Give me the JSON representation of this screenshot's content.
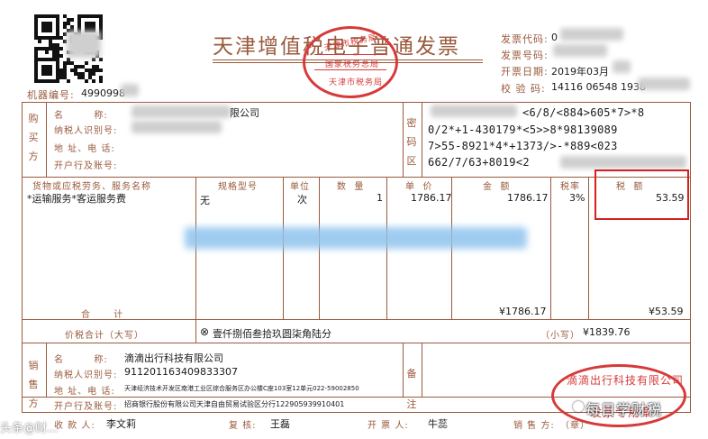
{
  "title": "天津增值税电子普通发票",
  "meta": {
    "code_label": "发票代码:",
    "code_value": "0",
    "number_label": "发票号码:",
    "number_value": "",
    "date_label": "开票日期:",
    "date_value": "2019年03月",
    "check_label": "校 验 码:",
    "check_value": "14116 06548 1938"
  },
  "machine": {
    "label": "机器编号:",
    "value": "4990998"
  },
  "buyer": {
    "section_label": [
      "购",
      "买",
      "方"
    ],
    "name_label": "名        称:",
    "name_value": "限公司",
    "tax_id_label": "纳税人识别号:",
    "address_label": "地 址、电 话:",
    "bank_label": "开户行及账号:"
  },
  "cipher": {
    "section_label": [
      "密",
      "码",
      "区"
    ],
    "lines": [
      "<6/8/<884>605*7>*8",
      "0/2*+1-430179*<5>>8*98139089",
      "7>55-8921*4*+1373/>-*889<023",
      "662/7/63+8019<2"
    ]
  },
  "items_header": {
    "name": "货物或应税劳务、服务名称",
    "spec": "规格型号",
    "unit": "单位",
    "quantity": "数  量",
    "price": "单  价",
    "amount": "金  额",
    "tax_rate": "税率",
    "tax": "税  额"
  },
  "items": [
    {
      "name": "*运输服务*客运服务费",
      "spec": "无",
      "unit": "次",
      "quantity": "1",
      "price": "1786.17",
      "amount": "1786.17",
      "tax_rate": "3%",
      "tax": "53.59"
    }
  ],
  "subtotal": {
    "label": "合      计",
    "amount": "¥1786.17",
    "tax": "¥53.59"
  },
  "total": {
    "label": "价税合计（大写）",
    "upper": "壹仟捌佰叁拾玖圆柒角陆分",
    "small_label": "（小写）",
    "small_value": "¥1839.76"
  },
  "seller": {
    "section_label": [
      "销",
      "售",
      "方"
    ],
    "name_label": "名        称:",
    "name_value": "滴滴出行科技有限公司",
    "tax_id_label": "纳税人识别号:",
    "tax_id_value": "911201163409833307",
    "address_label": "地 址、电 话:",
    "address_value": "天津经济技术开发区南港工业区综合服务区办公楼C座103室12单元022-59002850",
    "bank_label": "开户行及账号:",
    "bank_value": "招商银行股份有限公司天津自由贸易试验区分行122905939910401"
  },
  "remarks": {
    "section_label": [
      "备",
      "注"
    ]
  },
  "footer": {
    "payee_label": "收 款 人:",
    "payee_value": "李文莉",
    "reviewer_label": "复 核:",
    "reviewer_value": "王磊",
    "issuer_label": "开 票 人:",
    "issuer_value": "牛蕊",
    "seller_label": "销 售 方:",
    "seller_suffix": "（章）"
  },
  "stamps": {
    "official_top": "天津市税务局",
    "official_mid": "国家税务总局",
    "official_bottom": "天津市税务局",
    "company_arc": "滴滴出行科技有限公司",
    "company_bottom": "发票专用章"
  },
  "watermark": {
    "right": "每日学财税",
    "left": "头条@财..."
  },
  "colors": {
    "form_brown": "#9a5a3c",
    "stamp_red": "#d73a3a",
    "highlight_red": "#d32020"
  }
}
